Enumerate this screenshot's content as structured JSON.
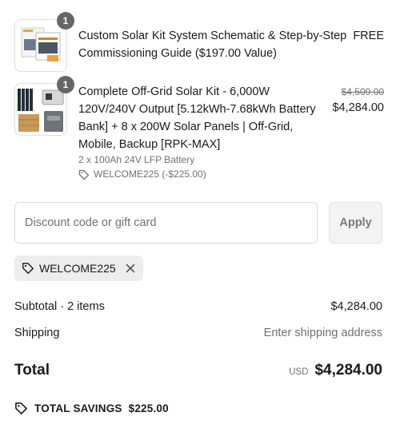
{
  "items": [
    {
      "quantity": "1",
      "title_lines": [
        "Custom Solar Kit System Schematic & Step-by-Step",
        "Commissioning Guide ($197.00 Value)"
      ],
      "price": "FREE"
    },
    {
      "quantity": "1",
      "title_lines": [
        "Complete Off-Grid Solar Kit - 6,000W",
        "120V/240V Output [5.12kWh-7.68kWh Battery",
        "Bank] + 8 x 200W Solar Panels | Off-Grid,",
        "Mobile, Backup [RPK-MAX]"
      ],
      "variant": "2 x 100Ah 24V LFP Battery",
      "discount_tag": "WELCOME225 (-$225.00)",
      "compare_at_price": "$4,509.00",
      "price": "$4,284.00"
    }
  ],
  "discount": {
    "placeholder": "Discount code or gift card",
    "apply_label": "Apply",
    "applied_code": "WELCOME225"
  },
  "summary": {
    "subtotal_label": "Subtotal · 2 items",
    "subtotal_value": "$4,284.00",
    "shipping_label": "Shipping",
    "shipping_value": "Enter shipping address",
    "total_label": "Total",
    "currency": "USD",
    "total_value": "$4,284.00",
    "savings_label": "TOTAL SAVINGS",
    "savings_value": "$225.00"
  },
  "icons": {
    "tag": "tag-icon",
    "remove": "close-icon"
  }
}
